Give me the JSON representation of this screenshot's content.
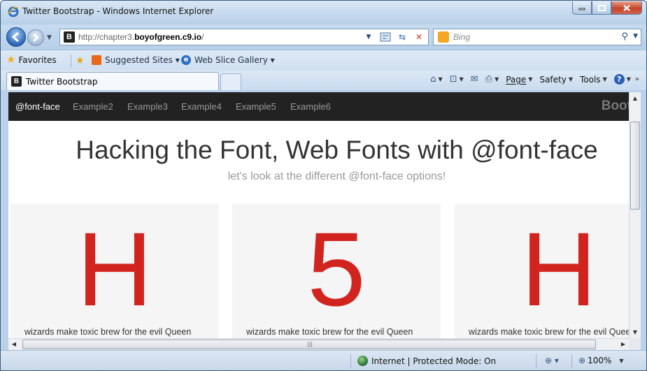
{
  "window": {
    "title": "Twitter Bootstrap - Windows Internet Explorer"
  },
  "addressbar": {
    "favicon_letter": "B",
    "url_prefix": "http://chapter3.",
    "url_domain": "boyofgreen.c9.io",
    "url_suffix": "/"
  },
  "search": {
    "placeholder": "Bing"
  },
  "favorites_bar": {
    "favorites_label": "Favorites",
    "links": [
      {
        "label": "Suggested Sites ▾"
      },
      {
        "label": "Web Slice Gallery ▾"
      }
    ]
  },
  "tab": {
    "favicon_letter": "B",
    "label": "Twitter Bootstrap"
  },
  "command_bar": {
    "page_label": "Page",
    "safety_label": "Safety",
    "tools_label": "Tools"
  },
  "page": {
    "nav_items": [
      "@font-face",
      "Example2",
      "Example3",
      "Example4",
      "Example5",
      "Example6"
    ],
    "active_index": 0,
    "brand": "Boot",
    "hero_title": "Hacking the Font, Web Fonts with @font-face",
    "hero_subtitle": "let's look at the different @font-face options!",
    "cards": [
      {
        "glyph": "H",
        "caption": "wizards make toxic brew for the evil Queen"
      },
      {
        "glyph": "5",
        "caption": "wizards make toxic brew for the evil Queen"
      },
      {
        "glyph": "H",
        "caption": "wizards make toxic brew for the evil Queen"
      }
    ]
  },
  "statusbar": {
    "zone_text": "Internet | Protected Mode: On",
    "zoom": "100%"
  },
  "colors": {
    "glyph_red": "#d2241f",
    "navbar_bg": "#222222",
    "card_bg": "#f5f5f5"
  }
}
